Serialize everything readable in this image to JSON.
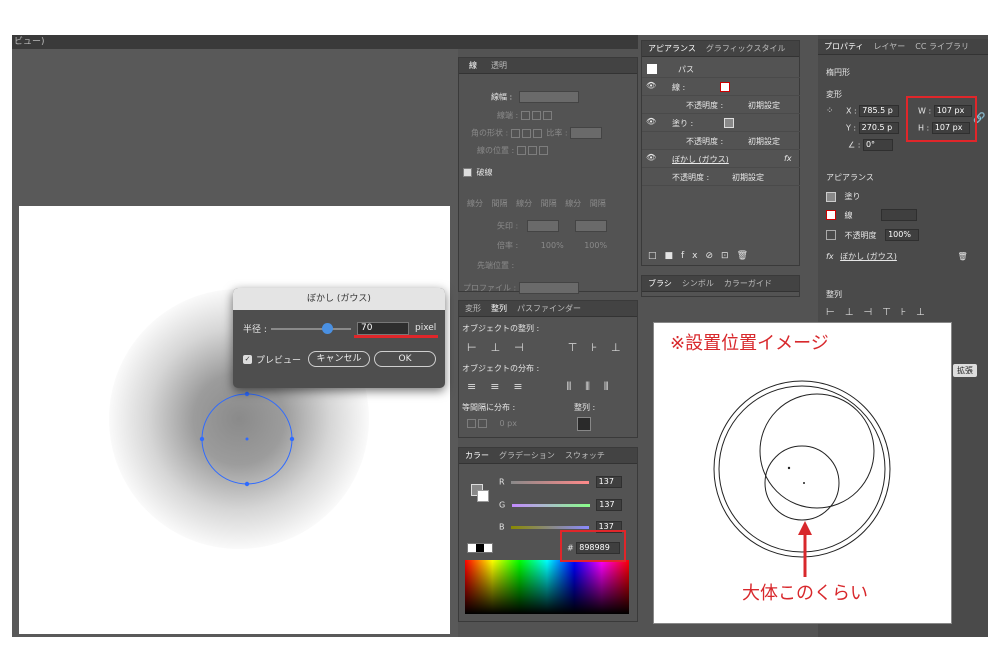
{
  "topbar": {
    "fragment": "ビュー)"
  },
  "stroke_panel": {
    "tabs": [
      "線",
      "透明"
    ],
    "weight_label": "線幅 :",
    "cap_label": "線端 :",
    "corner_label": "角の形状 :",
    "ratio_label": "比率 :",
    "align_label": "線の位置 :",
    "dashed_label": "破線",
    "dash_cols": [
      "線分",
      "間隔",
      "線分",
      "間隔",
      "線分",
      "間隔"
    ],
    "arrow_label": "矢印 :",
    "scale_label": "倍率 :",
    "scale_values": [
      "100%",
      "100%"
    ],
    "arrow_pos_label": "先端位置 :",
    "profile_label": "プロファイル :"
  },
  "align_panel": {
    "tabs": [
      "変形",
      "整列",
      "パスファインダー"
    ],
    "align_objects_label": "オブジェクトの整列 :",
    "distribute_objects_label": "オブジェクトの分布 :",
    "distribute_spacing_label": "等間隔に分布 :",
    "align_to_label": "整列 :",
    "spacing_value": "0 px"
  },
  "color_panel": {
    "tabs": [
      "カラー",
      "グラデーション",
      "スウォッチ"
    ],
    "channels": [
      {
        "label": "R",
        "value": "137"
      },
      {
        "label": "G",
        "value": "137"
      },
      {
        "label": "B",
        "value": "137"
      }
    ],
    "hex_label": "#",
    "hex_value": "898989"
  },
  "appearance_panel": {
    "tabs": [
      "アピアランス",
      "グラフィックスタイル"
    ],
    "title": "パス",
    "rows": [
      {
        "label": "線 :",
        "value": ""
      },
      {
        "label": "不透明度 :",
        "value": "初期設定"
      },
      {
        "label": "塗り :",
        "value": ""
      },
      {
        "label": "不透明度 :",
        "value": "初期設定"
      },
      {
        "label": "ぼかし (ガウス)",
        "value": "fx"
      },
      {
        "label": "不透明度 :",
        "value": "初期設定"
      }
    ]
  },
  "brush_panel": {
    "tabs": [
      "ブラシ",
      "シンボル",
      "カラーガイド"
    ]
  },
  "properties_panel": {
    "tabs": [
      "プロパティ",
      "レイヤー",
      "CC ライブラリ"
    ],
    "shape_type": "楕円形",
    "transform_label": "変形",
    "x_label": "X :",
    "x_value": "785.5 p",
    "y_label": "Y :",
    "y_value": "270.5 p",
    "w_label": "W :",
    "w_value": "107 px",
    "h_label": "H :",
    "h_value": "107 px",
    "angle_value": "0°",
    "appearance_label": "アピアランス",
    "fill_label": "塗り",
    "stroke_label": "線",
    "opacity_label": "不透明度",
    "opacity_value": "100%",
    "effect_label": "ぼかし (ガウス)",
    "align_label": "整列",
    "expand_label": "拡張"
  },
  "dialog": {
    "title": "ぼかし (ガウス)",
    "radius_label": "半径 :",
    "radius_value": "70",
    "unit": "pixel",
    "preview_label": "プレビュー",
    "cancel_label": "キャンセル",
    "ok_label": "OK",
    "radius_fraction": 0.7
  },
  "annotation": {
    "heading": "※設置位置イメージ",
    "caption": "大体このくらい"
  },
  "colors": {
    "highlight": "#e0262a",
    "selection": "#2f6bff",
    "ui_bg": "#535353"
  }
}
